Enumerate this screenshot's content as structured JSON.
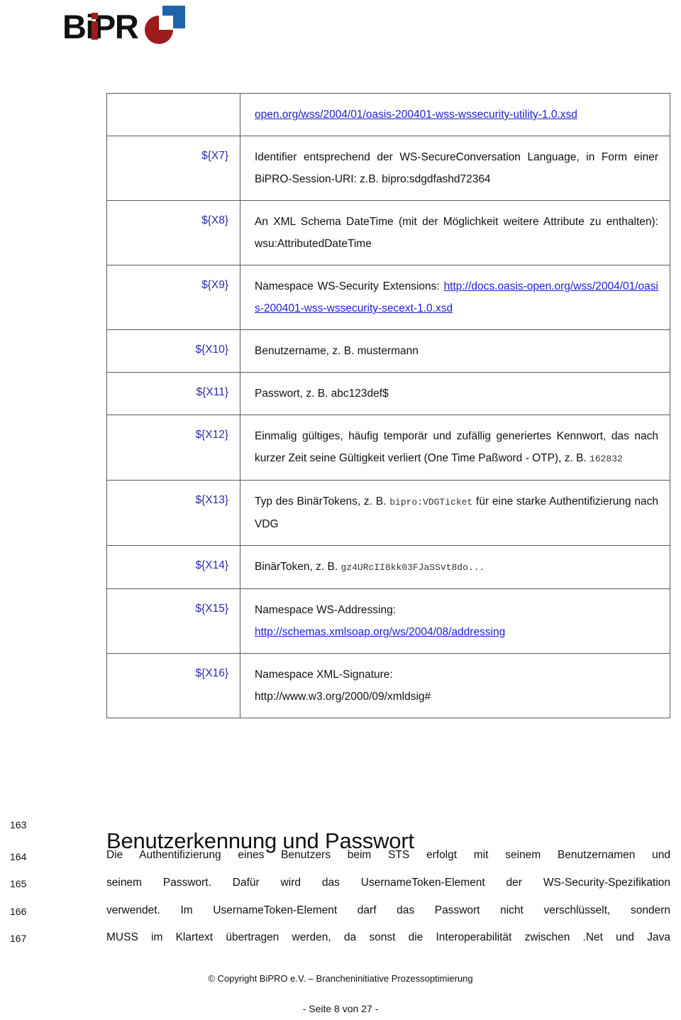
{
  "logo": {
    "text": "BiPRO",
    "wordmark": "BiPR",
    "colors": {
      "black": "#111111",
      "red": "#9e1b1b",
      "blue": "#1f62ae"
    }
  },
  "colors": {
    "key_blue": "#2b2bab",
    "link_blue": "#1e1ecb",
    "border_gray": "#595959",
    "text_black": "#111111"
  },
  "table": {
    "rows": [
      {
        "key": "",
        "value_plain": "",
        "link_text": "open.org/wss/2004/01/oasis-200401-wss-wssecurity-utility-1.0.xsd",
        "continuation": true
      },
      {
        "key": "${X7}",
        "value_plain": "Identifier entsprechend der WS-SecureConversation Language, in Form einer BiPRO-Session-URI: z.B. bipro:sdgdfashd72364"
      },
      {
        "key": "${X8}",
        "value_plain": "An XML Schema DateTime (mit der Möglichkeit weitere Attribute zu enthalten): wsu:AttributedDateTime"
      },
      {
        "key": "${X9}",
        "value_prefix": "Namespace WS-Security Extensions: ",
        "link_text": "http://docs.oasis-open.org/wss/2004/01/oasis-200401-wss-wssecurity-secext-1.0.xsd"
      },
      {
        "key": "${X10}",
        "value_plain": "Benutzername, z. B. mustermann"
      },
      {
        "key": "${X11}",
        "value_plain": "Passwort, z. B. abc123def$"
      },
      {
        "key": "${X12}",
        "value_prefix": "Einmalig gültiges, häufig temporär und zufällig generiertes Kennwort, das nach kurzer Zeit seine Gültigkeit verliert (One Time Paßword - OTP), z. B. ",
        "value_mono": "162832"
      },
      {
        "key": "${X13}",
        "value_prefix": "Typ des BinärTokens, z. B. ",
        "value_mono": "bipro:VDGTicket",
        "value_suffix": " für eine starke Authentifizierung nach VDG"
      },
      {
        "key": "${X14}",
        "value_prefix": "BinärToken, z. B. ",
        "value_mono": "gz4URcII8kk03FJaSSvt8do..."
      },
      {
        "key": "${X15}",
        "value_prefix": "Namespace WS-Addressing:",
        "link_text": "http://schemas.xmlsoap.org/ws/2004/08/addressing"
      },
      {
        "key": "${X16}",
        "value_prefix": "Namespace XML-Signature:",
        "value_suffix": "http://www.w3.org/2000/09/xmldsig#"
      }
    ]
  },
  "section": {
    "line_numbers": [
      "163",
      "164",
      "165",
      "166",
      "167"
    ],
    "heading": "Benutzerkennung und Passwort",
    "paragraph_lines": [
      "Die Authentifizierung eines Benutzers beim STS erfolgt mit seinem Benutzernamen und",
      "seinem Passwort. Dafür wird das UsernameToken-Element der WS-Security-Spezifikation",
      "verwendet. Im UsernameToken-Element darf das Passwort nicht verschlüsselt, sondern",
      "MUSS im Klartext übertragen werden, da sonst die Interoperabilität zwischen .Net und Java"
    ]
  },
  "footer": {
    "copyright": "© Copyright BiPRO e.V. – Brancheninitiative Prozessoptimierung",
    "page": "- Seite 8 von 27 -"
  }
}
